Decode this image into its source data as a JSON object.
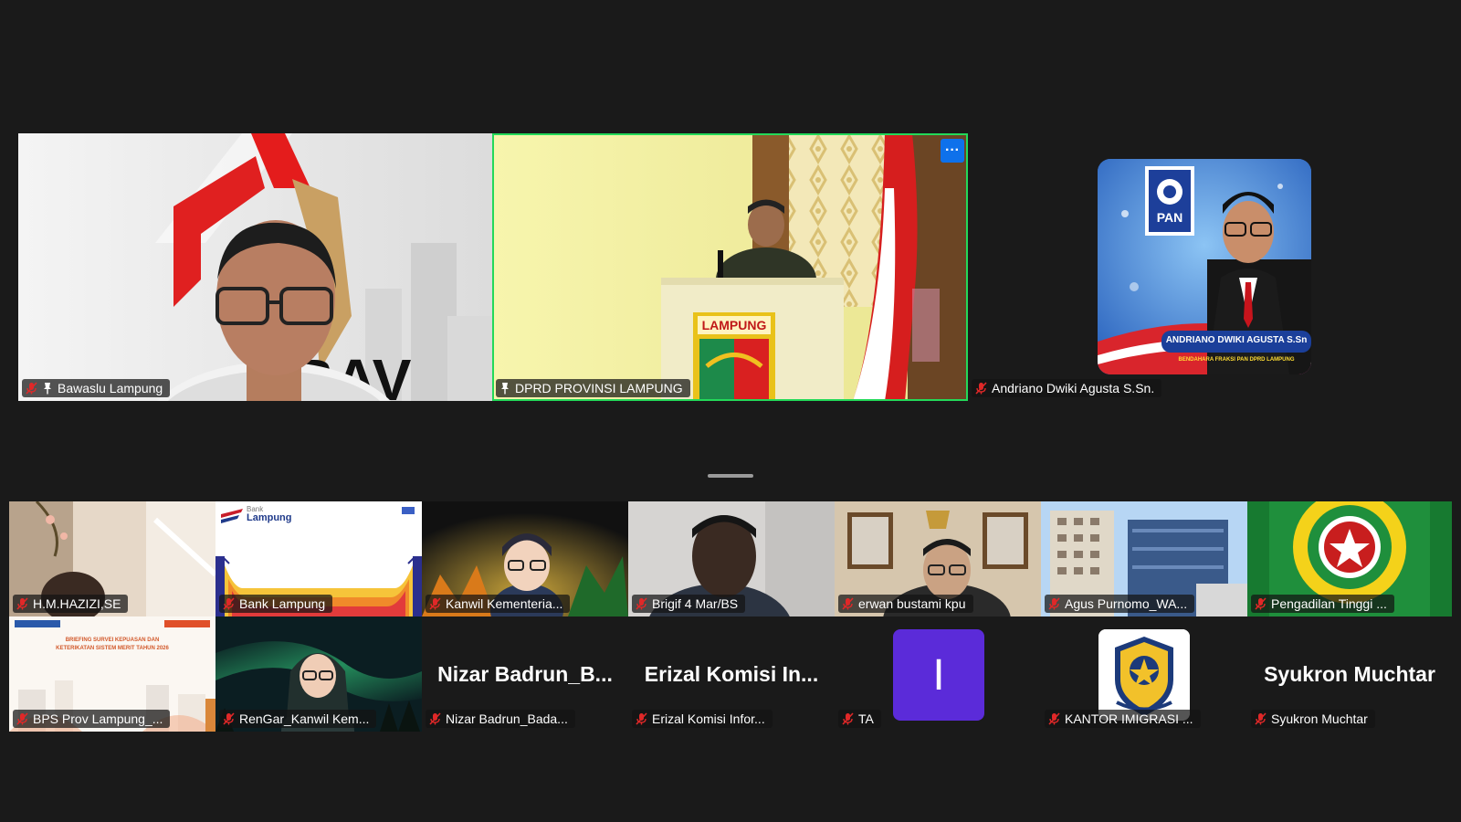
{
  "top_row": [
    {
      "name": "Bawaslu Lampung",
      "pinned": true,
      "muted": true
    },
    {
      "name": "DPRD PROVINSI LAMPUNG",
      "pinned": true,
      "muted": false,
      "active_speaker": true,
      "more_label": "···"
    },
    {
      "name": "Andriano Dwiki Agusta S.Sn.",
      "pinned": false,
      "muted": true,
      "poster_party": "PAN",
      "poster_name": "ANDRIANO DWIKI AGUSTA S.Sn",
      "poster_subtitle": "BENDAHARA FRAKSI PAN DPRD LAMPUNG"
    }
  ],
  "gallery_row1": [
    {
      "name": "H.M.HAZIZI,SE"
    },
    {
      "name": "Bank Lampung",
      "logo_small": "Bank",
      "logo_big": "Lampung"
    },
    {
      "name": "Kanwil Kementeria..."
    },
    {
      "name": "Brigif 4 Mar/BS"
    },
    {
      "name": "erwan bustami kpu"
    },
    {
      "name": "Agus Purnomo_WA..."
    },
    {
      "name": "Pengadilan Tinggi ..."
    }
  ],
  "gallery_row2": [
    {
      "name": "BPS Prov Lampung_...",
      "slide_text": "BRIEFING SURVEI KEPUASAN DAN KETERIKATAN SISTEM MERIT TAHUN 2026"
    },
    {
      "name": "RenGar_Kanwil Kem..."
    },
    {
      "name": "Nizar Badrun_Bada...",
      "display": "Nizar  Badrun_B..."
    },
    {
      "name": "Erizal Komisi Infor...",
      "display": "Erizal  Komisi  In..."
    },
    {
      "name": "TA",
      "avatar_letter": "I"
    },
    {
      "name": "KANTOR IMIGRASI ..."
    },
    {
      "name": "Syukron Muchtar",
      "display": "Syukron Muchtar"
    }
  ],
  "colors": {
    "background": "#1a1a1a",
    "active_border": "#23d959",
    "muted_icon": "#e02828",
    "avatar_purple": "#5b2bd9",
    "more_button": "#0e71eb"
  }
}
